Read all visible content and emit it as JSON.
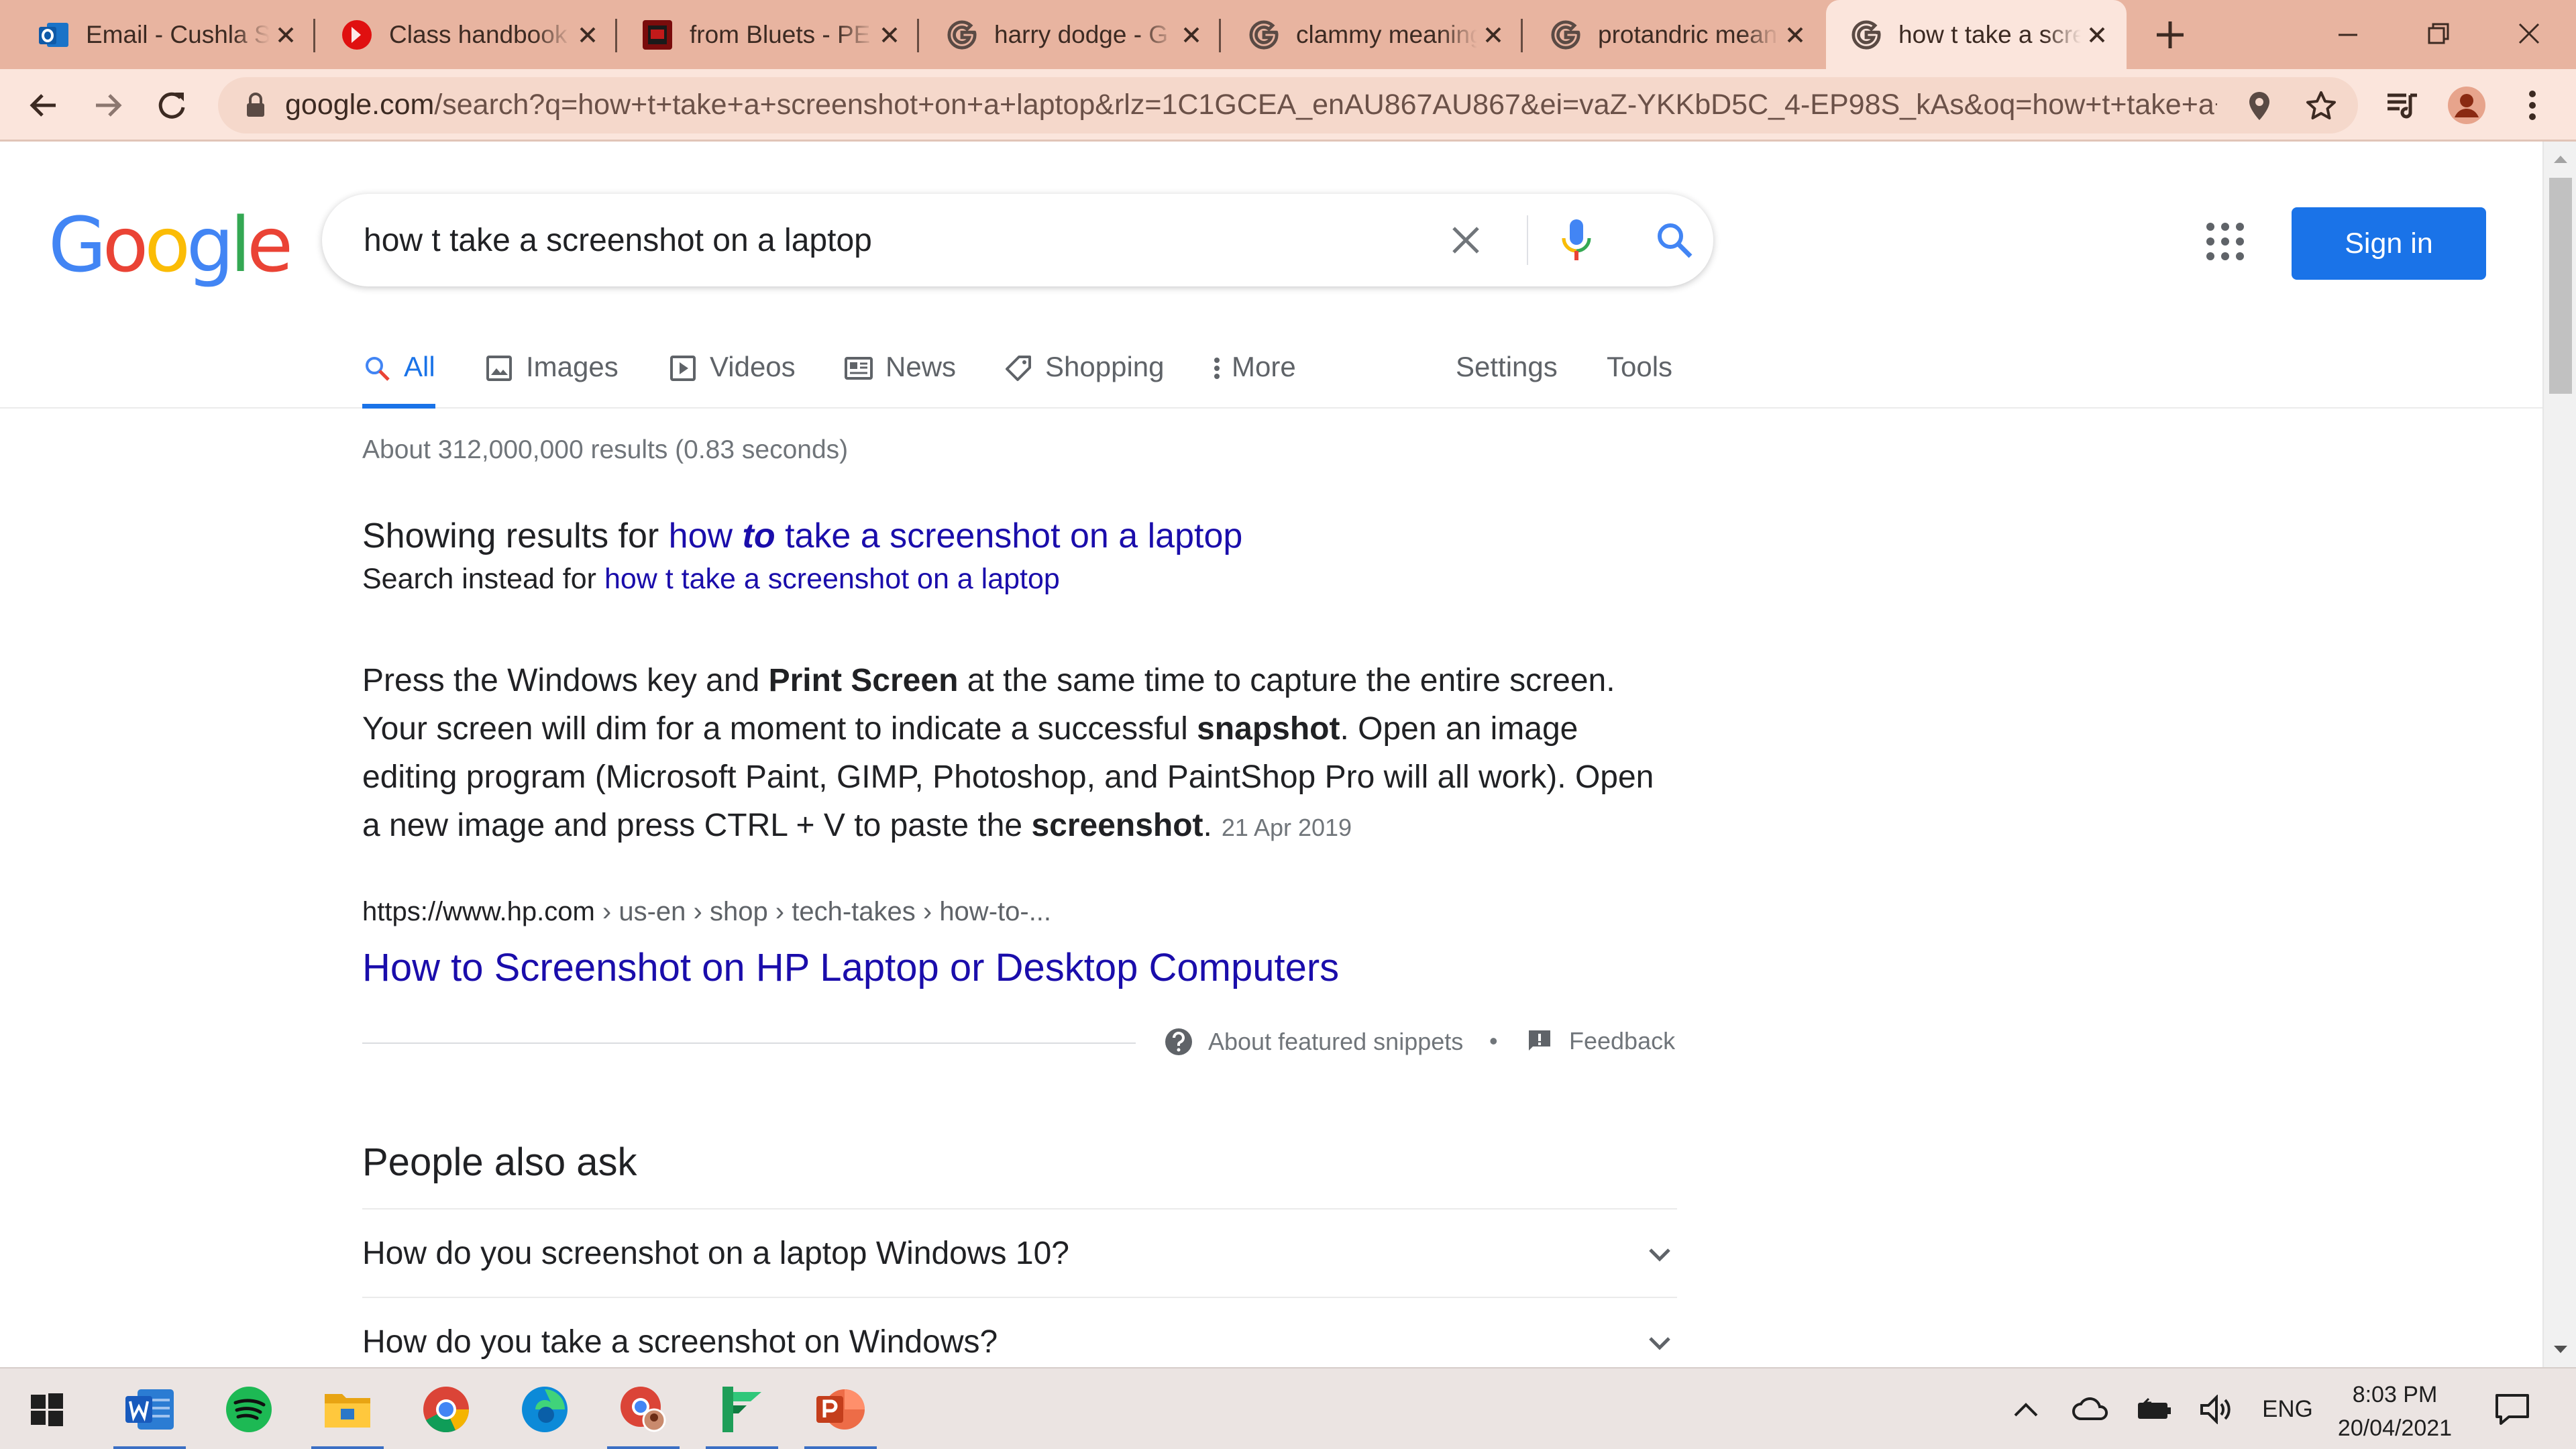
{
  "browser": {
    "tabs": [
      {
        "title": "Email - Cushla S",
        "favicon": "outlook-icon",
        "active": false
      },
      {
        "title": "Class handbook",
        "favicon": "class-handbook-icon",
        "active": false
      },
      {
        "title": "from Bluets - PE",
        "favicon": "bluets-icon",
        "active": false
      },
      {
        "title": "harry dodge - G",
        "favicon": "google-icon",
        "active": false
      },
      {
        "title": "clammy meaning",
        "favicon": "google-icon",
        "active": false
      },
      {
        "title": "protandric mean",
        "favicon": "google-icon",
        "active": false
      },
      {
        "title": "how t take a scre",
        "favicon": "google-icon",
        "active": true
      }
    ],
    "url_host": "google.com",
    "url_rest": "/search?q=how+t+take+a+screenshot+on+a+laptop&rlz=1C1GCEA_enAU867AU867&ei=vaZ-YKKbD5C_4-EP98S_kAs&oq=how+t+take+a+s..."
  },
  "google": {
    "logo": [
      "G",
      "o",
      "o",
      "g",
      "l",
      "e"
    ],
    "query": "how t take a screenshot on a laptop",
    "signin_label": "Sign in",
    "tabs": {
      "all": "All",
      "images": "Images",
      "videos": "Videos",
      "news": "News",
      "shopping": "Shopping",
      "more": "More",
      "settings": "Settings",
      "tools": "Tools"
    },
    "stats": "About 312,000,000 results (0.83 seconds)",
    "spell": {
      "showing_prefix": "Showing results for",
      "corrected_a": "how",
      "corrected_b": "to",
      "corrected_c": "take a screenshot on a laptop",
      "instead_prefix": "Search instead for",
      "instead_query": "how t take a screenshot on a laptop"
    },
    "featured_snippet": {
      "t1": "Press the Windows key and ",
      "b1": "Print Screen",
      "t2": " at the same time to capture the entire screen. Your screen will dim for a moment to indicate a successful ",
      "b2": "snapshot",
      "t3": ". Open an image editing program (Microsoft Paint, GIMP, Photoshop, and PaintShop Pro will all work). Open a new image and press CTRL + V to paste the ",
      "b3": "screenshot",
      "t4": ".",
      "date": "21 Apr 2019",
      "cite_host": "https://www.hp.com",
      "cite_path": " › us-en › shop › tech-takes › how-to-...",
      "title": "How to Screenshot on HP Laptop or Desktop Computers",
      "about_label": "About featured snippets",
      "feedback_label": "Feedback"
    },
    "people_also_ask": {
      "heading": "People also ask",
      "questions": [
        "How do you screenshot on a laptop Windows 10?",
        "How do you take a screenshot on Windows?"
      ]
    }
  },
  "taskbar": {
    "apps": [
      "word-icon",
      "spotify-icon",
      "file-explorer-icon",
      "chrome-icon",
      "edge-icon",
      "chrome-profile-icon",
      "sway-icon",
      "powerpoint-icon"
    ],
    "language": "ENG",
    "time": "8:03 PM",
    "date": "20/04/2021"
  },
  "colors": {
    "tab_strip": "#e8b4a0",
    "toolbar": "#fbe5dc",
    "link": "#1a0dab",
    "accent_blue": "#1a73e8"
  }
}
